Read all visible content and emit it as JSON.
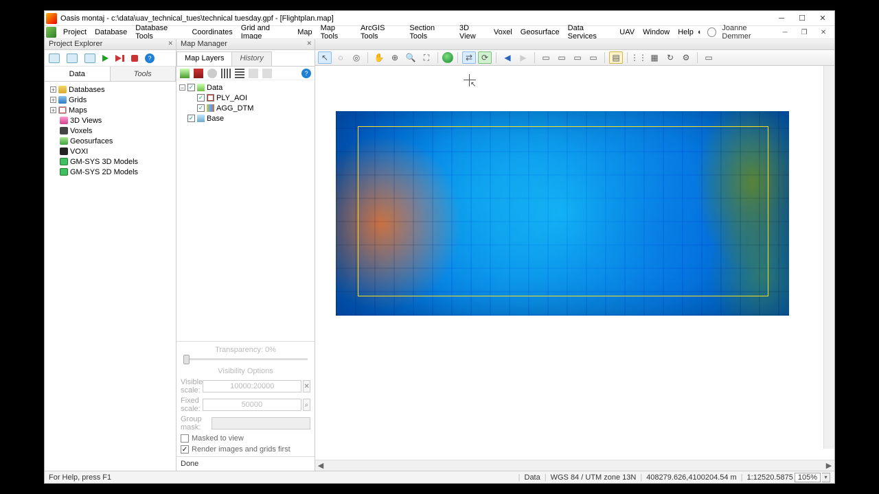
{
  "app": {
    "title": "Oasis montaj - c:\\data\\uav_technical_tues\\technical tuesday.gpf - [Flightplan.map]",
    "user": "Joanne Demmer"
  },
  "menus": [
    "Project",
    "Database",
    "Database Tools",
    "Coordinates",
    "Grid and Image",
    "Map",
    "Map Tools",
    "ArcGIS Tools",
    "Section Tools",
    "3D View",
    "Voxel",
    "Geosurface",
    "Data Services",
    "UAV",
    "Window",
    "Help"
  ],
  "panels": {
    "explorer": "Project Explorer",
    "mapmgr": "Map Manager"
  },
  "explorer": {
    "tabs": {
      "data": "Data",
      "tools": "Tools"
    },
    "nodes": [
      {
        "label": "Databases",
        "icon": "ic-db"
      },
      {
        "label": "Grids",
        "icon": "ic-grid"
      },
      {
        "label": "Maps",
        "icon": "ic-map"
      },
      {
        "label": "3D Views",
        "icon": "ic-3d"
      },
      {
        "label": "Voxels",
        "icon": "ic-vox"
      },
      {
        "label": "Geosurfaces",
        "icon": "ic-geo"
      },
      {
        "label": "VOXI",
        "icon": "ic-voxi"
      },
      {
        "label": "GM-SYS 3D Models",
        "icon": "ic-gm"
      },
      {
        "label": "GM-SYS 2D Models",
        "icon": "ic-gm"
      }
    ]
  },
  "mapmgr": {
    "tabs": {
      "layers": "Map Layers",
      "history": "History"
    },
    "tree": {
      "root": "Data",
      "children": [
        {
          "label": "PLY_AOI",
          "icon": "li-pfly"
        },
        {
          "label": "AGG_DTM",
          "icon": "li-agg"
        }
      ],
      "base": "Base"
    },
    "transparency_label": "Transparency: 0%",
    "visibility_label": "Visibility Options",
    "visible_scale_label": "Visible scale:",
    "visible_scale_value": "10000:20000",
    "fixed_scale_label": "Fixed scale:",
    "fixed_scale_value": "50000",
    "group_mask_label": "Group mask:",
    "masked_label": "Masked to view",
    "render_first_label": "Render images and grids first",
    "done": "Done"
  },
  "status": {
    "help": "For Help, press F1",
    "view": "Data",
    "crs": "WGS 84 / UTM zone 13N",
    "coords": "408279.626,4100204.54 m",
    "scale": "1:12520.5875",
    "zoom": "105%"
  },
  "chart_data": {
    "type": "map",
    "title": "Flightplan.map",
    "layers": [
      "AGG_DTM (shaded relief grid)",
      "PLY_AOI (polygon area of interest, yellow outline)"
    ],
    "crs": "WGS 84 / UTM zone 13N",
    "cursor_xy": [
      408279.626,
      4100204.54
    ],
    "scale": 12520.5875,
    "aoi_color": "#ffe020"
  }
}
